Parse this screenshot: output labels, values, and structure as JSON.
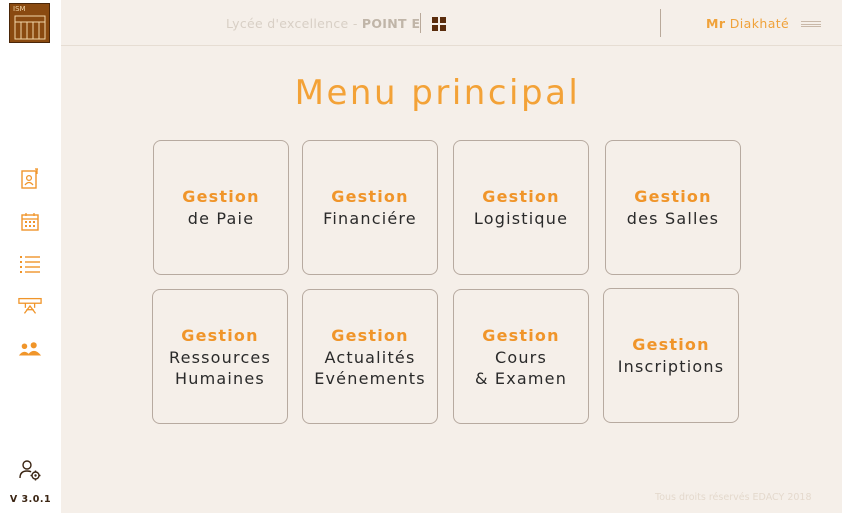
{
  "app": {
    "logo_text": "ISM",
    "version": "V 3.0.1",
    "accent_color": "#f0952a",
    "brand_color": "#8a4a10"
  },
  "header": {
    "school_name": "Lycée d'excellence",
    "school_separator": "-",
    "school_point": "POINT E",
    "apps_icon": "grid-icon",
    "user_title": "Mr",
    "user_name": "Diakhaté",
    "menu_icon": "hamburger-icon"
  },
  "sidebar": {
    "items": [
      {
        "icon": "id-card-icon"
      },
      {
        "icon": "calendar-icon"
      },
      {
        "icon": "list-icon"
      },
      {
        "icon": "classroom-icon"
      },
      {
        "icon": "users-icon"
      }
    ],
    "settings_icon": "user-settings-icon"
  },
  "main": {
    "title": "Menu principal",
    "cards": [
      {
        "l1": "Gestion",
        "l2": "de Paie",
        "l3": ""
      },
      {
        "l1": "Gestion",
        "l2": "Financiére",
        "l3": ""
      },
      {
        "l1": "Gestion",
        "l2": "Logistique",
        "l3": ""
      },
      {
        "l1": "Gestion",
        "l2": "des Salles",
        "l3": ""
      },
      {
        "l1": "Gestion",
        "l2": "Ressources",
        "l3": "Humaines"
      },
      {
        "l1": "Gestion",
        "l2": "Actualités",
        "l3": "Evénements"
      },
      {
        "l1": "Gestion",
        "l2": "Cours",
        "l3": "& Examen"
      },
      {
        "l1": "Gestion",
        "l2": "Inscriptions",
        "l3": ""
      }
    ]
  },
  "footer": {
    "copyright": "Tous droits réservés EDACY 2018"
  }
}
